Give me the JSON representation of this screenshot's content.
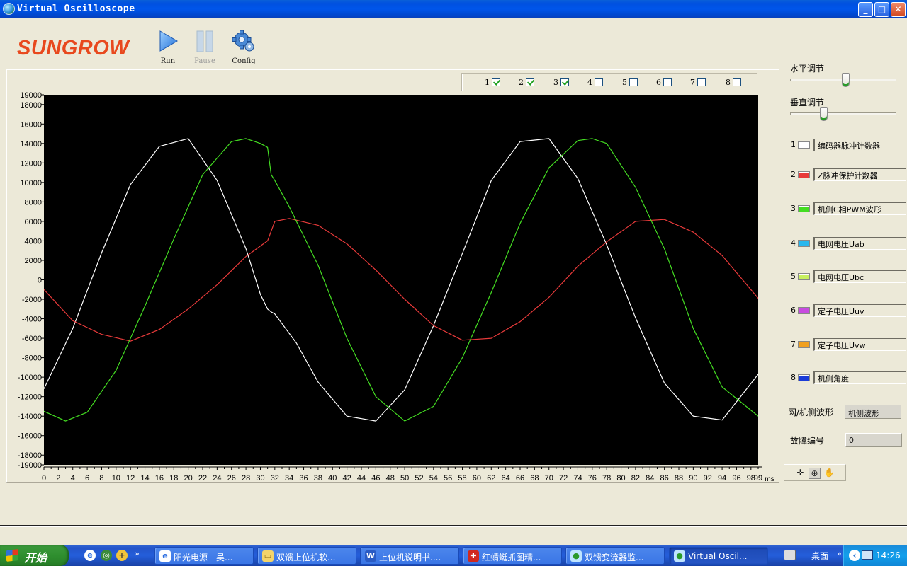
{
  "window": {
    "title": "Virtual Oscilloscope",
    "min": "_",
    "max": "□",
    "close": "✕"
  },
  "toolbar": {
    "logo": "SUNGROW",
    "run": "Run",
    "pause": "Pause",
    "config": "Config",
    "icons": {
      "run": "play-icon",
      "pause": "pause-icon",
      "config": "gear-icon"
    }
  },
  "channel_checks": [
    {
      "label": "1",
      "checked": true
    },
    {
      "label": "2",
      "checked": true
    },
    {
      "label": "3",
      "checked": true
    },
    {
      "label": "4",
      "checked": false
    },
    {
      "label": "5",
      "checked": false
    },
    {
      "label": "6",
      "checked": false
    },
    {
      "label": "7",
      "checked": false
    },
    {
      "label": "8",
      "checked": false
    }
  ],
  "controls": {
    "horizontal": "水平调节",
    "vertical": "垂直调节",
    "horizontal_level": 0.52,
    "vertical_level": 0.31
  },
  "channels": [
    {
      "num": "1",
      "name": "编码器脉冲计数器",
      "color": "#FFFFFF"
    },
    {
      "num": "2",
      "name": "Z脉冲保护计数器",
      "color": "#E83A3A"
    },
    {
      "num": "3",
      "name": "机侧C相PWM波形",
      "color": "#44DD22"
    },
    {
      "num": "4",
      "name": "电网电压Uab",
      "color": "#29B7EE"
    },
    {
      "num": "5",
      "name": "电网电压Ubc",
      "color": "#C8F060"
    },
    {
      "num": "6",
      "name": "定子电压Uuv",
      "color": "#C84CE0"
    },
    {
      "num": "7",
      "name": "定子电压Uvw",
      "color": "#F0A020"
    },
    {
      "num": "8",
      "name": "机侧角度",
      "color": "#1A3CD8"
    }
  ],
  "wave_select": {
    "label": "网/机侧波形",
    "value": "机侧波形"
  },
  "fault": {
    "label": "故障编号",
    "value": "0"
  },
  "zoom_tools": [
    "cursor-icon",
    "zoom-icon",
    "pan-hand-icon"
  ],
  "chart_data": {
    "type": "line",
    "xlabel": "ms",
    "xlim": [
      0,
      99
    ],
    "ylim": [
      -19000,
      19000
    ],
    "grid": false,
    "background": "#000000",
    "x_ticks": [
      0,
      2,
      4,
      6,
      8,
      10,
      12,
      14,
      16,
      18,
      20,
      22,
      24,
      26,
      28,
      30,
      32,
      34,
      36,
      38,
      40,
      42,
      44,
      46,
      48,
      50,
      52,
      54,
      56,
      58,
      60,
      62,
      64,
      66,
      68,
      70,
      72,
      74,
      76,
      78,
      80,
      82,
      84,
      86,
      88,
      90,
      92,
      94,
      96,
      98,
      99
    ],
    "y_ticks": [
      19000,
      18000,
      16000,
      14000,
      12000,
      10000,
      8000,
      6000,
      4000,
      2000,
      0,
      -2000,
      -4000,
      -6000,
      -8000,
      -10000,
      -12000,
      -14000,
      -16000,
      -18000,
      -19000
    ],
    "series": [
      {
        "color": "#FFFFFF",
        "x": [
          0,
          4,
          8,
          12,
          16,
          20,
          24,
          28,
          30,
          31,
          31.5,
          32,
          35,
          38,
          42,
          46,
          50,
          54,
          58,
          62,
          66,
          70,
          74,
          78,
          82,
          86,
          90,
          94,
          99
        ],
        "values": [
          -11200,
          -5000,
          2800,
          9800,
          13700,
          14500,
          10200,
          3200,
          -1500,
          -3000,
          -3300,
          -3500,
          -6500,
          -10500,
          -14000,
          -14500,
          -11300,
          -4700,
          2700,
          10200,
          14200,
          14500,
          10400,
          3600,
          -3900,
          -10600,
          -14000,
          -14400,
          -9700
        ]
      },
      {
        "color": "#E83A3A",
        "x": [
          0,
          4,
          8,
          12,
          16,
          20,
          24,
          28,
          31,
          32,
          34,
          38,
          42,
          46,
          50,
          54,
          58,
          62,
          66,
          70,
          74,
          78,
          82,
          86,
          90,
          94,
          99
        ],
        "values": [
          -1000,
          -4200,
          -5600,
          -6300,
          -5100,
          -3000,
          -500,
          2400,
          4000,
          6000,
          6300,
          5600,
          3700,
          1000,
          -2000,
          -4700,
          -6200,
          -6000,
          -4300,
          -1800,
          1400,
          3900,
          6000,
          6200,
          4900,
          2500,
          -1900
        ]
      },
      {
        "color": "#44DD22",
        "x": [
          0,
          3,
          6,
          10,
          14,
          18,
          22,
          26,
          28,
          30,
          31,
          31.5,
          32,
          34,
          38,
          42,
          46,
          50,
          54,
          58,
          62,
          66,
          70,
          74,
          76,
          78,
          82,
          86,
          90,
          94,
          99
        ],
        "values": [
          -13500,
          -14500,
          -13600,
          -9300,
          -2700,
          4200,
          10800,
          14200,
          14500,
          14000,
          13600,
          10800,
          10200,
          7500,
          1500,
          -6000,
          -12000,
          -14500,
          -13000,
          -8000,
          -1300,
          5800,
          11500,
          14300,
          14500,
          14000,
          9500,
          3200,
          -5000,
          -11000,
          -14000
        ]
      }
    ]
  }
}
